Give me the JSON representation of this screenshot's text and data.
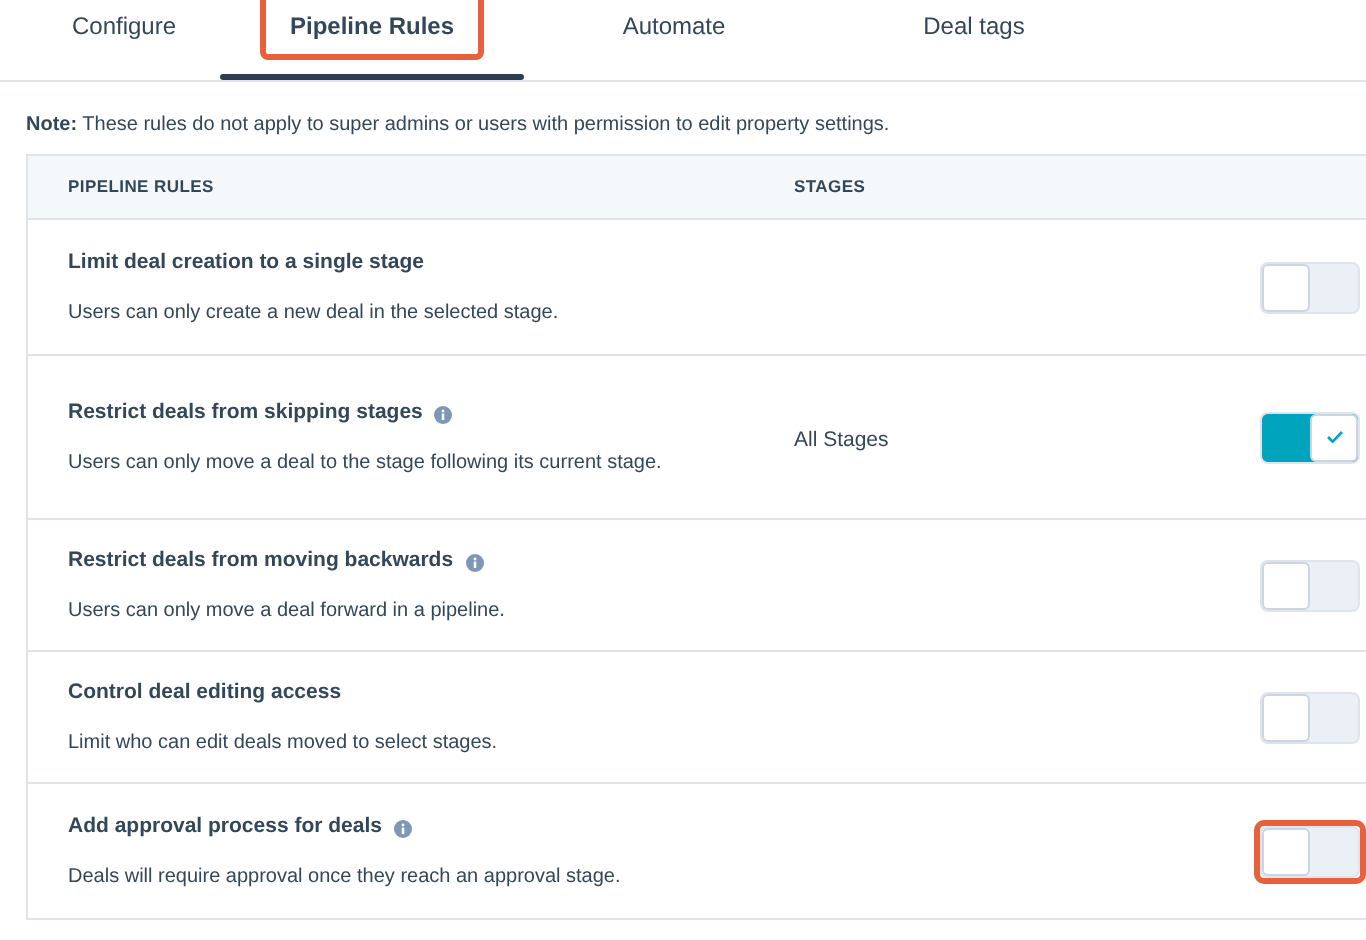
{
  "tabs": [
    {
      "label": "Configure",
      "selected": false,
      "highlighted": false
    },
    {
      "label": "Pipeline Rules",
      "selected": true,
      "highlighted": true
    },
    {
      "label": "Automate",
      "selected": false,
      "highlighted": false
    },
    {
      "label": "Deal tags",
      "selected": false,
      "highlighted": false
    }
  ],
  "note": "**Note:** These rules do not apply to super admins or users with permission to edit property settings.",
  "table": {
    "columns": [
      "PIPELINE RULES",
      "STAGES"
    ],
    "rows": [
      {
        "title": "Limit deal creation to a single stage",
        "info": false,
        "description": "Users can only create a new deal in the selected stage.",
        "on": false,
        "highlighted": false
      },
      {
        "title": "Restrict deals from skipping stages",
        "info": true,
        "description": "Users can only move a deal to the stage following its current stage.",
        "stages": "All Stages",
        "on": true,
        "highlighted": false
      },
      {
        "title": "Restrict deals from moving backwards",
        "info": true,
        "description": "Users can only move a deal forward in a pipeline.",
        "on": false,
        "highlighted": false
      },
      {
        "title": "Control deal editing access",
        "info": false,
        "description": "Limit who can edit deals moved to select stages.",
        "on": false,
        "highlighted": false
      },
      {
        "title": "Add approval process for deals",
        "info": true,
        "description": "Deals will require approval once they reach an approval stage.",
        "on": false,
        "highlighted": true
      }
    ]
  }
}
